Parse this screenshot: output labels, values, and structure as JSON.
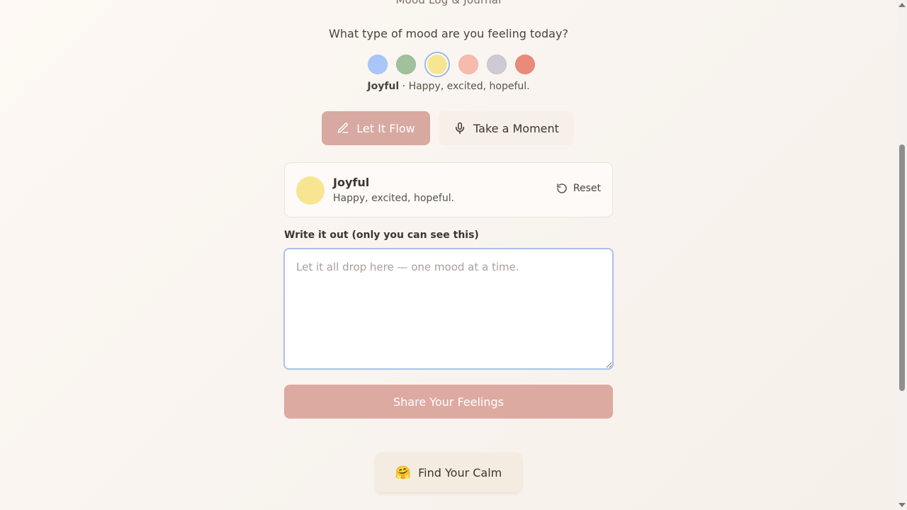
{
  "header": {
    "cut_title": "Mood Log & Journal",
    "question": "What type of mood are you feeling today?"
  },
  "moods": [
    {
      "name": "mood-blue",
      "color": "#a9c6fb"
    },
    {
      "name": "mood-green",
      "color": "#9fc19c"
    },
    {
      "name": "mood-yellow",
      "color": "#f8e591",
      "selected": true
    },
    {
      "name": "mood-peach",
      "color": "#f6bbad"
    },
    {
      "name": "mood-gray",
      "color": "#cdcad5"
    },
    {
      "name": "mood-red",
      "color": "#e98b79"
    }
  ],
  "selected_caption": {
    "name": "Joyful",
    "separator": " · ",
    "desc": "Happy, excited, hopeful."
  },
  "modes": {
    "flow_label": "Let It Flow",
    "moment_label": "Take a Moment"
  },
  "mood_card": {
    "title": "Joyful",
    "desc": "Happy, excited, hopeful.",
    "reset_label": "Reset"
  },
  "journal": {
    "label": "Write it out (only you can see this)",
    "placeholder": "Let it all drop here — one mood at a time.",
    "value": ""
  },
  "actions": {
    "share_label": "Share Your Feelings",
    "calm_label": "Find Your Calm",
    "calm_emoji": "🤗"
  }
}
